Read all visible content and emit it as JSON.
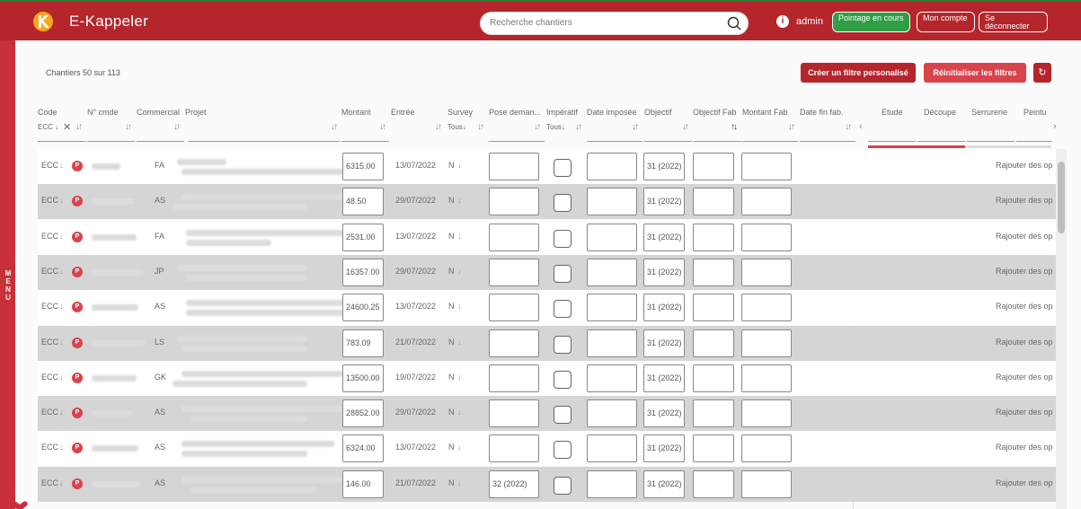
{
  "header": {
    "brand": "E-Kappeler",
    "search_placeholder": "Recherche chantiers",
    "user": "admin",
    "btn_pointage": "Pointage en cours",
    "btn_account": "Mon compte",
    "btn_logout": "Se déconnecter"
  },
  "sidebar": {
    "menu_label": "MENU"
  },
  "toolbar": {
    "count": "Chantiers 50 sur 113",
    "create_filter": "Créer un filtre personalisé",
    "reset_filters": "Réinitialiser les filtres"
  },
  "columns": {
    "code": "Code",
    "ncmde": "N° cmde",
    "commercial": "Commercial",
    "projet": "Projet",
    "montant": "Montant",
    "entree": "Entrée",
    "survey": "Survey",
    "pose": "Pose deman...",
    "imperatif": "Impératif",
    "date_imposee": "Date imposée",
    "objectif": "Objectif",
    "objectif_fab": "Objectif Fab",
    "montant_fab": "Montant Fab",
    "date_fin_fab": "Date fin fab.",
    "etude": "Etude",
    "decoupe": "Découpe",
    "serrurerie": "Serrurerie",
    "peinture": "Peintu"
  },
  "filters": {
    "code": "ECC",
    "survey": "Tous",
    "imperatif": "Tous"
  },
  "progress": {
    "fraction": 0.53
  },
  "rows": [
    {
      "code": "ECC",
      "commercial": "FA",
      "montant": "6315.00",
      "entree": "13/07/2022",
      "survey": "N",
      "pose": "",
      "objectif": "31 (2022)",
      "action": "Rajouter des op"
    },
    {
      "code": "ECC",
      "commercial": "AS",
      "montant": "48.50",
      "entree": "29/07/2022",
      "survey": "N",
      "pose": "",
      "objectif": "31 (2022)",
      "action": "Rajouter des op"
    },
    {
      "code": "ECC",
      "commercial": "FA",
      "montant": "2531.00",
      "entree": "13/07/2022",
      "survey": "N",
      "pose": "",
      "objectif": "31 (2022)",
      "action": "Rajouter des op"
    },
    {
      "code": "ECC",
      "commercial": "JP",
      "montant": "16357.00",
      "entree": "29/07/2022",
      "survey": "N",
      "pose": "",
      "objectif": "31 (2022)",
      "action": "Rajouter des op"
    },
    {
      "code": "ECC",
      "commercial": "AS",
      "montant": "24600.25",
      "entree": "13/07/2022",
      "survey": "N",
      "pose": "",
      "objectif": "31 (2022)",
      "action": "Rajouter des op"
    },
    {
      "code": "ECC",
      "commercial": "LS",
      "montant": "783.09",
      "entree": "21/07/2022",
      "survey": "N",
      "pose": "",
      "objectif": "31 (2022)",
      "action": "Rajouter des op"
    },
    {
      "code": "ECC",
      "commercial": "GK",
      "montant": "13500.00",
      "entree": "19/07/2022",
      "survey": "N",
      "pose": "",
      "objectif": "31 (2022)",
      "action": "Rajouter des op"
    },
    {
      "code": "ECC",
      "commercial": "AS",
      "montant": "28852.00",
      "entree": "29/07/2022",
      "survey": "N",
      "pose": "",
      "objectif": "31 (2022)",
      "action": "Rajouter des op"
    },
    {
      "code": "ECC",
      "commercial": "AS",
      "montant": "6324.00",
      "entree": "13/07/2022",
      "survey": "N",
      "pose": "",
      "objectif": "31 (2022)",
      "action": "Rajouter des op"
    },
    {
      "code": "ECC",
      "commercial": "AS",
      "montant": "146.00",
      "entree": "21/07/2022",
      "survey": "N",
      "pose": "32 (2022)",
      "objectif": "31 (2022)",
      "action": "Rajouter des op"
    }
  ]
}
